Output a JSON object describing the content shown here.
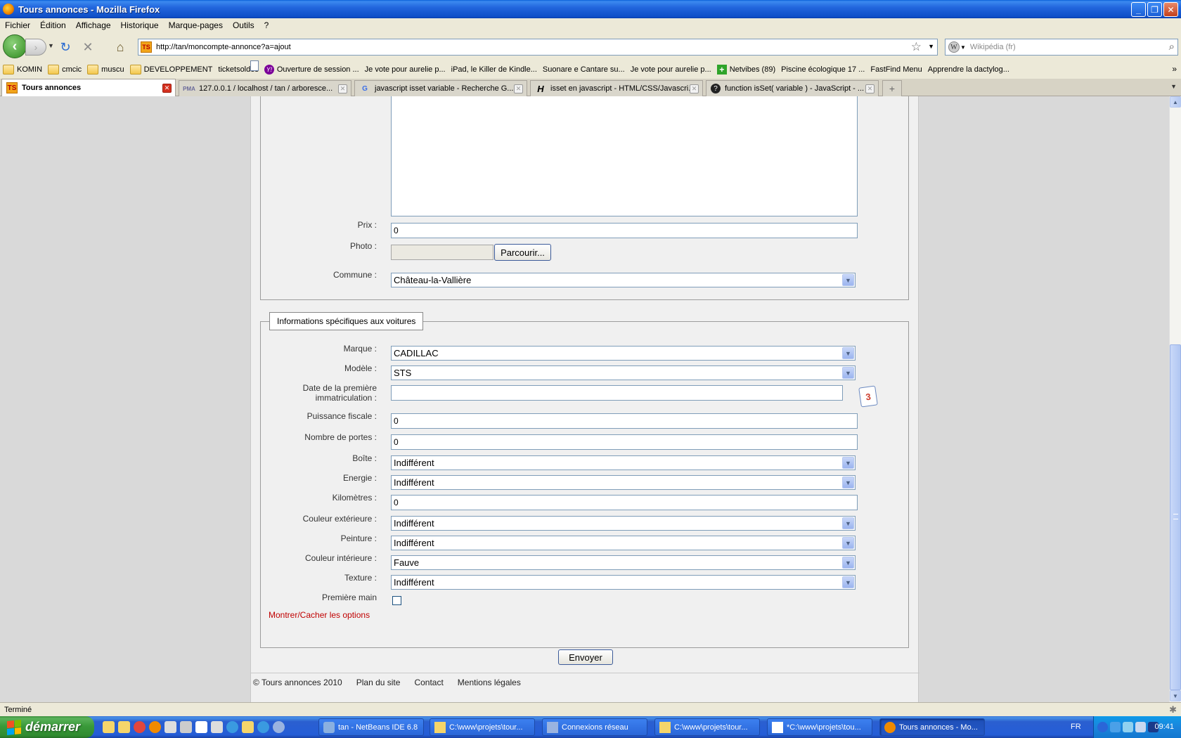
{
  "window": {
    "title": "Tours annonces - Mozilla Firefox",
    "minimize": "_",
    "maximize": "❐",
    "close": "✕"
  },
  "menu": [
    "Fichier",
    "Édition",
    "Affichage",
    "Historique",
    "Marque-pages",
    "Outils",
    "?"
  ],
  "nav": {
    "url": "http://tan/moncompte-annonce?a=ajout",
    "favicon_text": "TS",
    "search_placeholder": "Wikipédia (fr)",
    "search_engine_letter": "W"
  },
  "bookmarks": [
    {
      "label": "KOMIN",
      "icon": "folder"
    },
    {
      "label": "cmcic",
      "icon": "folder"
    },
    {
      "label": "muscu",
      "icon": "folder"
    },
    {
      "label": "DEVELOPPEMENT",
      "icon": "folder"
    },
    {
      "label": "ticketsoldes",
      "icon": "page"
    },
    {
      "label": "Ouverture de session ...",
      "icon": "yahoo"
    },
    {
      "label": "Je vote pour aurelie p...",
      "icon": "page"
    },
    {
      "label": "iPad, le Killer de Kindle...",
      "icon": "page"
    },
    {
      "label": "Suonare e Cantare su...",
      "icon": "page"
    },
    {
      "label": "Je vote pour aurelie p...",
      "icon": "page"
    },
    {
      "label": "Netvibes (89)",
      "icon": "plus"
    },
    {
      "label": "Piscine écologique 17 ...",
      "icon": "page"
    },
    {
      "label": "FastFind Menu",
      "icon": "page"
    },
    {
      "label": "Apprendre la dactylog...",
      "icon": "page"
    }
  ],
  "tabs": [
    {
      "label": "Tours annonces",
      "icon": "TS"
    },
    {
      "label": "127.0.0.1 / localhost / tan / arboresce...",
      "icon": "PMA"
    },
    {
      "label": "javascript isset variable - Recherche G...",
      "icon": "G"
    },
    {
      "label": "isset en javascript - HTML/CSS/Javascri...",
      "icon": "H"
    },
    {
      "label": "function isSet( variable ) - JavaScript - ...",
      "icon": "?"
    }
  ],
  "form": {
    "prix": {
      "label": "Prix :",
      "value": "0"
    },
    "photo": {
      "label": "Photo :",
      "button": "Parcourir..."
    },
    "commune": {
      "label": "Commune :",
      "value": "Château-la-Vallière"
    },
    "cars_legend": "Informations spécifiques aux voitures",
    "marque": {
      "label": "Marque :",
      "value": "CADILLAC"
    },
    "modele": {
      "label": "Modèle :",
      "value": "STS"
    },
    "date_line1": "Date de la première",
    "date_line2": "immatriculation :",
    "date_value": "",
    "calendar_day": "3",
    "puissance": {
      "label": "Puissance fiscale :",
      "value": "0"
    },
    "portes": {
      "label": "Nombre de portes :",
      "value": "0"
    },
    "boite": {
      "label": "Boîte :",
      "value": "Indifférent"
    },
    "energie": {
      "label": "Energie :",
      "value": "Indifférent"
    },
    "km": {
      "label": "Kilomètres :",
      "value": "0"
    },
    "couleur_ext": {
      "label": "Couleur extérieure :",
      "value": "Indifférent"
    },
    "peinture": {
      "label": "Peinture :",
      "value": "Indifférent"
    },
    "couleur_int": {
      "label": "Couleur intérieure :",
      "value": "Fauve"
    },
    "texture": {
      "label": "Texture :",
      "value": "Indifférent"
    },
    "premiere_main": {
      "label": "Première main",
      "checked": false
    },
    "toggle_options": "Montrer/Cacher les options",
    "submit": "Envoyer"
  },
  "footer": {
    "copyright": "© Tours annonces 2010",
    "plan": "Plan du site",
    "contact": "Contact",
    "mentions": "Mentions légales"
  },
  "status": "Terminé",
  "taskbar": {
    "start": "démarrer",
    "tasks": [
      {
        "label": "tan - NetBeans IDE 6.8",
        "icon": "netbeans"
      },
      {
        "label": "C:\\www\\projets\\tour...",
        "icon": "folder"
      },
      {
        "label": "Connexions réseau",
        "icon": "network"
      },
      {
        "label": "C:\\www\\projets\\tour...",
        "icon": "folder"
      },
      {
        "label": "*C:\\www\\projets\\tou...",
        "icon": "editor"
      },
      {
        "label": "Tours annonces - Mo...",
        "icon": "firefox"
      }
    ],
    "lang": "FR",
    "clock": "09:41"
  }
}
